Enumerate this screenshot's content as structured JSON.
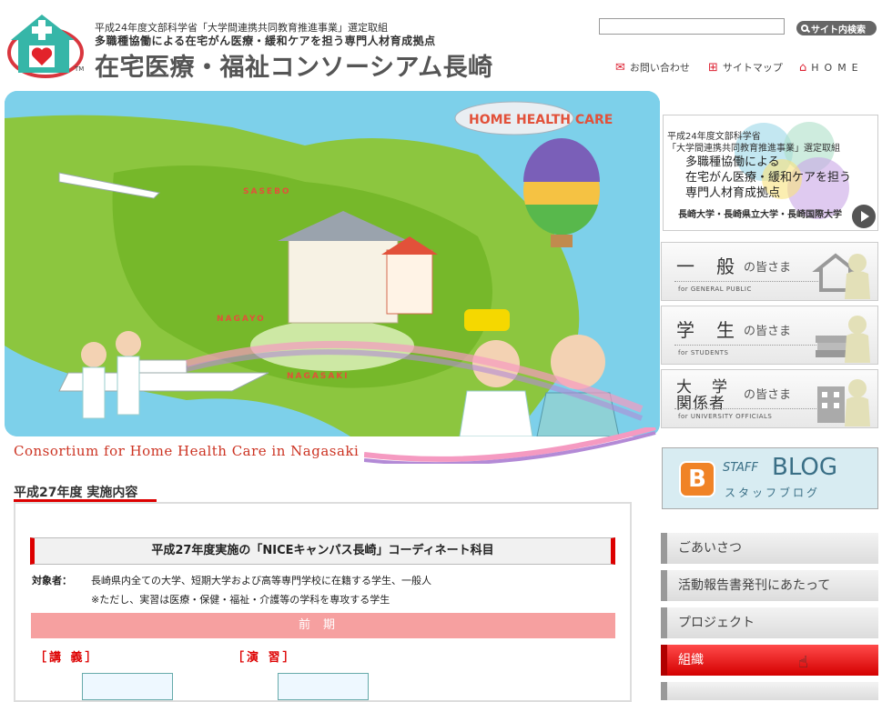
{
  "header": {
    "line1": "平成24年度文部科学省「大学間連携共同教育推進事業」選定取組",
    "line2": "多職種協働による在宅がん医療・緩和ケアを担う専門人材育成拠点",
    "title": "在宅医療・福祉コンソーシアム長崎",
    "tm": "TM",
    "search": {
      "value": "",
      "button_label": "サイト内検索"
    },
    "nav": {
      "contact": "お問い合わせ",
      "sitemap": "サイトマップ",
      "home": "HOME"
    }
  },
  "hero": {
    "blimp_text": "HOME HEALTH CARE",
    "places": [
      "SASEBO",
      "NAGAYO",
      "NAGASAKI"
    ],
    "caption": "Consortium for Home Health Care in Nagasaki"
  },
  "side_banner": {
    "line1": "平成24年度文部科学省",
    "line2": "「大学間連携共同教育推進事業」選定取組",
    "big1": "多職種協働による",
    "big2": "在宅がん医療・緩和ケアを担う",
    "big3": "専門人材育成拠点",
    "universities": "長崎大学・長崎県立大学・長崎国際大学"
  },
  "audiences": [
    {
      "big": "一般",
      "sub": "の皆さま",
      "en": "for GENERAL PUBLIC"
    },
    {
      "big": "学生",
      "sub": "の皆さま",
      "en": "for STUDENTS"
    },
    {
      "big1": "大学",
      "big2": "関係者",
      "sub": "の皆さま",
      "en": "for UNIVERSITY OFFICIALS"
    }
  ],
  "blog": {
    "t1": "STAFF",
    "t2": "BLOG",
    "t3": "スタッフブログ"
  },
  "menu": [
    {
      "label": "ごあいさつ"
    },
    {
      "label": "活動報告書発刊にあたって"
    },
    {
      "label": "プロジェクト"
    },
    {
      "label": "組織"
    }
  ],
  "content": {
    "section_title": "平成27年度 実施内容",
    "course_heading": "平成27年度実施の「NICEキャンパス長崎」コーディネート科目",
    "target_label": "対象者：",
    "target_text": "長崎県内全ての大学、短期大学および高等専門学校に在籍する学生、一般人",
    "target_note": "※ただし、実習は医療・保健・福祉・介護等の学科を専攻する学生",
    "term": "前期",
    "lecture": "［講 義］",
    "practice": "［演 習］"
  },
  "colors": {
    "accent_red": "#d00000",
    "hero_sea": "#7dd0ea",
    "land_green": "#8cc63f",
    "term_pink": "#f6a0a0"
  }
}
